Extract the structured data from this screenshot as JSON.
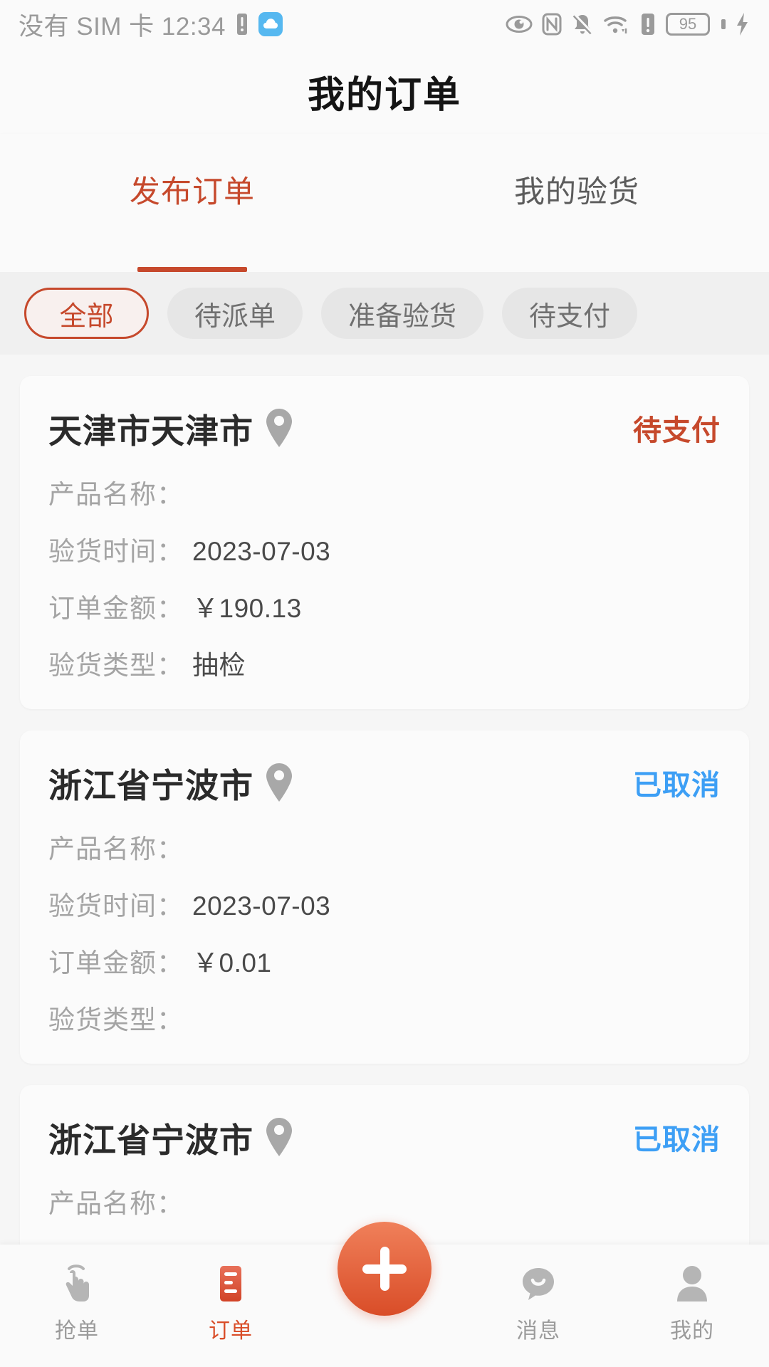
{
  "status_bar": {
    "carrier_time": "没有 SIM 卡 12:34",
    "battery_level": "95",
    "icons": [
      "sim-card-icon",
      "cloud-icon",
      "eye-icon",
      "nfc-icon",
      "bell-muted-icon",
      "wifi-icon",
      "sim-alert-icon",
      "battery-icon",
      "charging-bolt-icon"
    ]
  },
  "header": {
    "title": "我的订单"
  },
  "tabs": [
    {
      "label": "发布订单",
      "active": true
    },
    {
      "label": "我的验货",
      "active": false
    }
  ],
  "filters": [
    {
      "label": "全部",
      "active": true
    },
    {
      "label": "待派单",
      "active": false
    },
    {
      "label": "准备验货",
      "active": false
    },
    {
      "label": "待支付",
      "active": false
    }
  ],
  "labels": {
    "product_name": "产品名称：",
    "inspect_time": "验货时间：",
    "order_amount": "订单金额：",
    "inspect_type": "验货类型："
  },
  "orders": [
    {
      "location": "天津市天津市",
      "status": "待支付",
      "status_color": "#c6492c",
      "product_name": "",
      "inspect_time": "2023-07-03",
      "order_amount": "￥190.13",
      "inspect_type": "抽检"
    },
    {
      "location": "浙江省宁波市",
      "status": "已取消",
      "status_color": "#3d9ff5",
      "product_name": "",
      "inspect_time": "2023-07-03",
      "order_amount": "￥0.01",
      "inspect_type": ""
    },
    {
      "location": "浙江省宁波市",
      "status": "已取消",
      "status_color": "#3d9ff5",
      "product_name": "",
      "inspect_time": "",
      "order_amount": "",
      "inspect_type": ""
    }
  ],
  "bottom_nav": [
    {
      "label": "抢单",
      "icon": "tap-hand-icon",
      "active": false
    },
    {
      "label": "订单",
      "icon": "order-list-icon",
      "active": true
    },
    {
      "label": "消息",
      "icon": "chat-bubble-icon",
      "active": false
    },
    {
      "label": "我的",
      "icon": "person-icon",
      "active": false
    }
  ],
  "fab": {
    "icon": "plus-icon"
  },
  "colors": {
    "accent_red": "#c6492c",
    "fab_orange": "#d94d28",
    "cancel_blue": "#3d9ff5",
    "page_bg": "#f6f6f6"
  }
}
